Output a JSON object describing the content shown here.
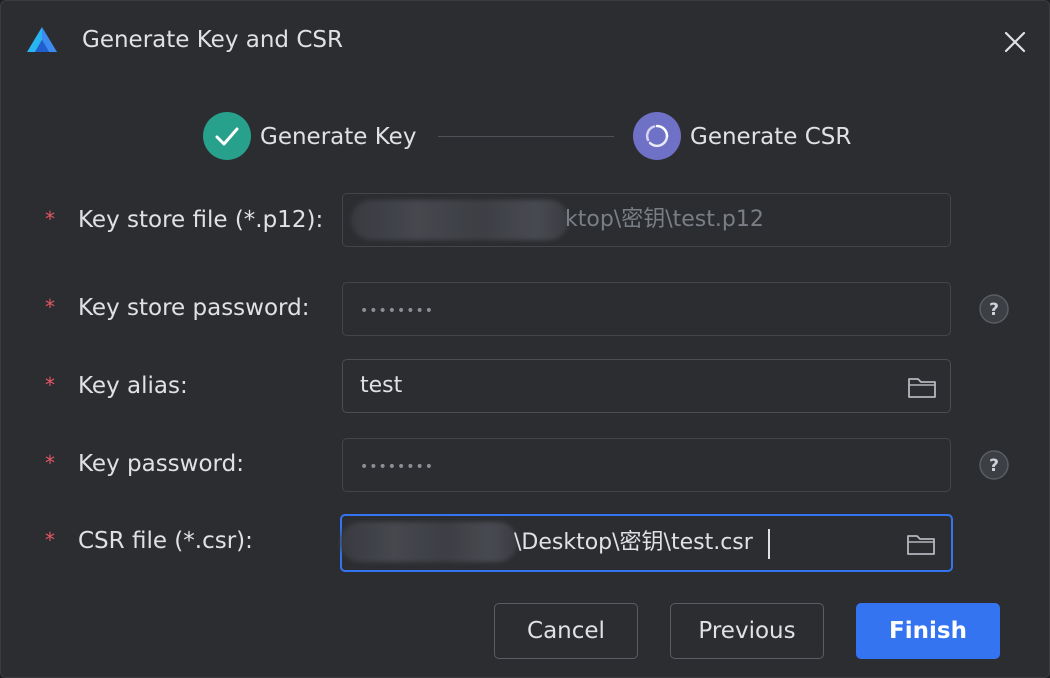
{
  "dialog": {
    "title": "Generate Key and CSR",
    "app_icon": "deveco-logo-icon",
    "close_icon": "close-icon"
  },
  "steps": [
    {
      "label": "Generate Key",
      "state": "completed",
      "icon": "check-icon",
      "color": "#27a18b"
    },
    {
      "label": "Generate CSR",
      "state": "in-progress",
      "icon": "spinner-icon",
      "color": "#6e71c6"
    }
  ],
  "form": {
    "required_marker": "*",
    "key_store_file": {
      "label": "Key store file (*.p12):",
      "value": "ktop\\密钥\\test.p12",
      "disabled": true
    },
    "key_store_password": {
      "label": "Key store password:",
      "value": "••••••••",
      "disabled": true,
      "help_icon": "help-icon"
    },
    "key_alias": {
      "label": "Key alias:",
      "value": "test",
      "action_icon": "folder-icon"
    },
    "key_password": {
      "label": "Key password:",
      "value": "••••••••",
      "disabled": true,
      "help_icon": "help-icon"
    },
    "csr_file": {
      "label": "CSR file (*.csr):",
      "value": "\\Desktop\\密钥\\test.csr",
      "focused": true,
      "action_icon": "folder-icon"
    }
  },
  "buttons": {
    "cancel": "Cancel",
    "previous": "Previous",
    "finish": "Finish"
  },
  "colors": {
    "background": "#2b2d30",
    "accent": "#3574f0",
    "required": "#e55765",
    "step_done": "#27a18b",
    "step_active": "#6e71c6",
    "text": "#dfe1e5"
  }
}
